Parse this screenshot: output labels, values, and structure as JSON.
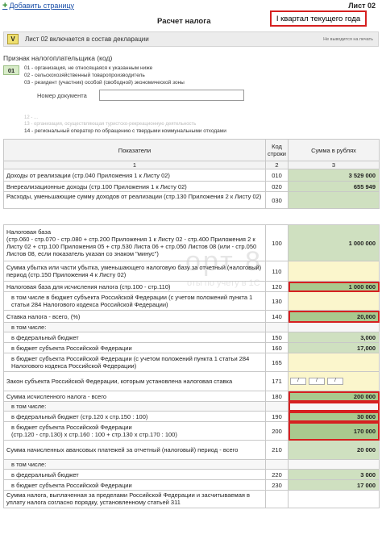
{
  "header": {
    "add_page_icon": "plus-icon",
    "add_page": "Добавить страницу",
    "sheet": "Лист 02",
    "title": "Расчет налога",
    "period": "I квартал текущего года"
  },
  "inclusion": {
    "check": "V",
    "label": "Лист 02 включается в состав декларации",
    "note": "Не выводится на печать"
  },
  "payer": {
    "title": "Признак налогоплательщика (код)",
    "code": "01",
    "options": [
      "01 - организация, не относящаяся к указанным ниже",
      "02 - сельскохозяйственный товаропроизводитель",
      "03 - резидент (участник) особой (свободной) экономической зоны"
    ],
    "doc_label": "Номер документа",
    "doc_value": "",
    "faded": [
      "12 - ...",
      "13 - организация, осуществляющая туристско-рекреационную деятельность"
    ],
    "option14": "14 - региональный оператор по обращению с твердыми коммунальными отходами"
  },
  "table": {
    "headers": [
      "Показатели",
      "Код строки",
      "Сумма в рублях"
    ],
    "numbers": [
      "1",
      "2",
      "3"
    ],
    "rows": [
      {
        "label": "Доходы от реализации (стр.040 Приложения 1 к Листу 02)",
        "code": "010",
        "value": "3 529 000"
      },
      {
        "label": "Внереализационные доходы (стр.100 Приложения 1 к Листу 02)",
        "code": "020",
        "value": "655 949"
      },
      {
        "label": "Расходы, уменьшающие сумму доходов от реализации (стр.130 Приложения 2 к Листу 02)",
        "code": "030",
        "value": ""
      },
      {
        "label": "Налоговая база\n(стр.060 - стр.070 - стр.080 + стр.200 Приложения 1 к Листу 02 - стр.400 Приложения 2 к Листу 02 + стр.100 Приложения 05 + стр.530 Листа 06 + стр.050 Листов 08 (или - стр.050 Листов 08, если показатель указан со знаком \"минус\")",
        "code": "100",
        "value": "1 000 000"
      },
      {
        "label": "Сумма убытка или части убытка, уменьшающего налоговую базу за отчетный (налоговый) период (стр.150 Приложения 4 к Листу 02)",
        "code": "110",
        "value": ""
      },
      {
        "label": "Налоговая база для исчисления налога (стр.100 - стр.110)",
        "code": "120",
        "value": "1 000 000"
      },
      {
        "label": "в том числе в бюджет субъекта Российской Федерации (с учетом положений пункта 1 статьи 284 Налогового кодекса Российской Федерации)",
        "code": "130",
        "value": ""
      },
      {
        "label": "Ставка налога - всего, (%)",
        "code": "140",
        "value": "20,000"
      },
      {
        "label": "в том числе:",
        "code": "",
        "value": ""
      },
      {
        "label": "в федеральный бюджет",
        "code": "150",
        "value": "3,000"
      },
      {
        "label": "в бюджет субъекта Российской Федерации",
        "code": "160",
        "value": "17,000"
      },
      {
        "label": "в бюджет субъекта Российской Федерации (с учетом положений пункта 1 статьи 284 Налогового кодекса Российской Федерации)",
        "code": "165",
        "value": ""
      },
      {
        "label": "Закон субъекта Российской Федерации, которым установлена налоговая ставка",
        "code": "171",
        "value": ""
      },
      {
        "label": "Сумма исчисленного налога - всего",
        "code": "180",
        "value": "200 000"
      },
      {
        "label": "в том числе:",
        "code": "",
        "value": ""
      },
      {
        "label": "в федеральный бюджет (стр.120 x стр.150 : 100)",
        "code": "190",
        "value": "30 000"
      },
      {
        "label": "в бюджет субъекта Российской Федерации\n(стр.120 - стр.130) x стр.160 : 100 + стр.130 x стр.170 : 100)",
        "code": "200",
        "value": "170 000"
      },
      {
        "label": "Сумма начисленных авансовых платежей за отчетный (налоговый) период - всего",
        "code": "210",
        "value": "20 000"
      },
      {
        "label": "в том числе:",
        "code": "",
        "value": ""
      },
      {
        "label": "в федеральный бюджет",
        "code": "220",
        "value": "3 000"
      },
      {
        "label": "в бюджет субъекта Российской Федерации",
        "code": "230",
        "value": "17 000"
      },
      {
        "label": "Сумма налога, выплаченная за пределами Российской Федерации и засчитываемая в уплату налога согласно порядку, установленному статьей 311",
        "code": "",
        "value": ""
      }
    ],
    "law_slots": [
      "/",
      "/",
      "/"
    ]
  },
  "watermark": {
    "main": "орт 8",
    "sub": "оты по учету в 1С"
  },
  "colors": {
    "highlight": "#d62020",
    "cell_green": "#cfe0c0",
    "cell_yellow": "#fbf6cc"
  }
}
